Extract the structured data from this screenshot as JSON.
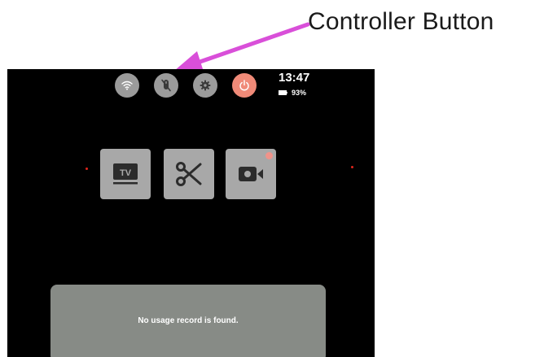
{
  "annotation": {
    "label": "Controller Button",
    "arrow_color": "#d94fd9"
  },
  "status_bar": {
    "quick_settings": [
      {
        "name": "wifi",
        "icon": "wifi-icon"
      },
      {
        "name": "controller",
        "icon": "controller-off-icon"
      },
      {
        "name": "settings",
        "icon": "gear-icon"
      },
      {
        "name": "power",
        "icon": "power-icon",
        "color": "#f08a78"
      }
    ],
    "time": "13:47",
    "battery_percent": "93%"
  },
  "apps": [
    {
      "name": "tv",
      "icon": "tv-icon"
    },
    {
      "name": "screenshot",
      "icon": "scissors-icon"
    },
    {
      "name": "record",
      "icon": "video-camera-icon",
      "badge": "record-dot"
    }
  ],
  "usage": {
    "empty_message": "No usage record is found."
  }
}
